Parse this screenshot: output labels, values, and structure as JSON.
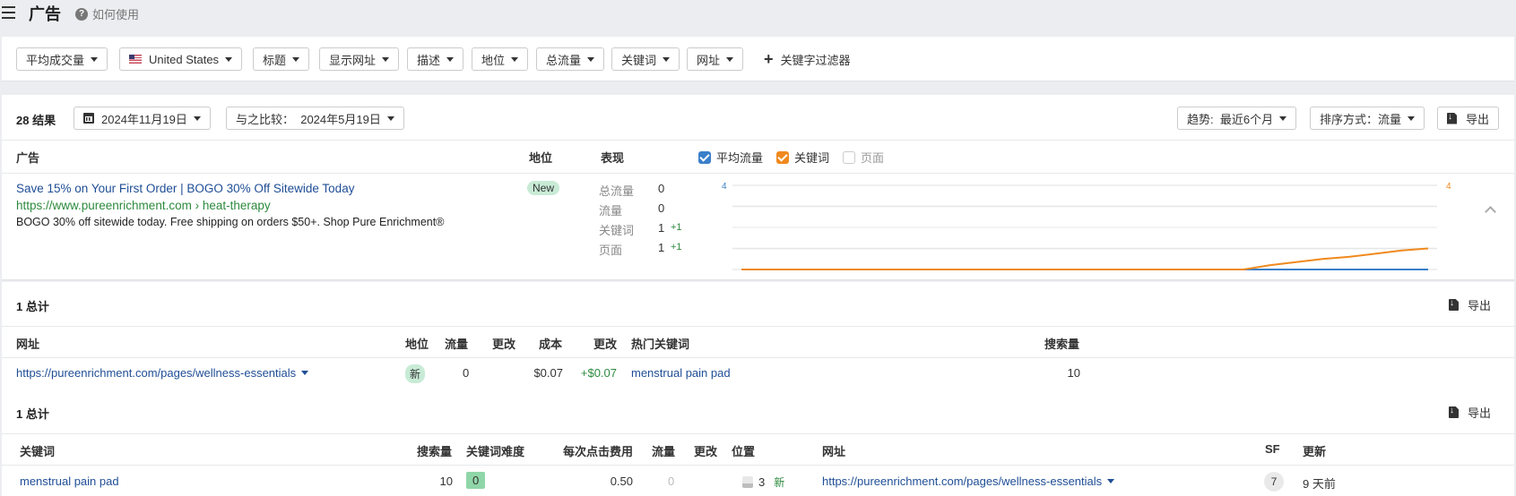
{
  "header": {
    "title": "广告",
    "help_label": "如何使用"
  },
  "filters": [
    {
      "label": "平均成交量"
    },
    {
      "label": "United States",
      "flag": "us-flag"
    },
    {
      "label": "标题"
    },
    {
      "label": "显示网址"
    },
    {
      "label": "描述"
    },
    {
      "label": "地位"
    },
    {
      "label": "总流量"
    },
    {
      "label": "关键词"
    },
    {
      "label": "网址"
    }
  ],
  "add_filter_label": "关键字过滤器",
  "toolbar": {
    "results_count": "28 结果",
    "date_label": "2024年11月19日",
    "compare_label": "与之比较：  2024年5月19日",
    "trend_label": "趋势:  最近6个月",
    "sort_label": "排序方式：流量",
    "export_label": "导出"
  },
  "ads_table": {
    "headers": {
      "ad": "广告",
      "position": "地位",
      "performance": "表现"
    },
    "legend": [
      {
        "label": "平均流量",
        "checked": true,
        "color": "#3a7fc9"
      },
      {
        "label": "关键词",
        "checked": true,
        "color": "#f0891e"
      },
      {
        "label": "页面",
        "checked": false,
        "color": "#cccccc"
      }
    ],
    "row": {
      "title": "Save 15% on Your First Order | BOGO 30% Off Sitewide Today",
      "display_url": "https://www.pureenrichment.com › heat-therapy",
      "description": "BOGO 30% off sitewide today. Free shipping on orders $50+. Shop Pure Enrichment®",
      "position_badge": "New",
      "metrics": [
        {
          "label": "总流量",
          "value": "0",
          "delta": ""
        },
        {
          "label": "流量",
          "value": "0",
          "delta": ""
        },
        {
          "label": "关键词",
          "value": "1",
          "delta": "+1"
        },
        {
          "label": "页面",
          "value": "1",
          "delta": "+1"
        }
      ]
    }
  },
  "chart_data": {
    "type": "line",
    "title": "",
    "left_axis_max_label": "4",
    "right_axis_max_label": "4",
    "ylim": [
      0,
      4
    ],
    "x": [
      0,
      1,
      2,
      3,
      4,
      5,
      6,
      7,
      8,
      9,
      10,
      11,
      12,
      13,
      14,
      15,
      16,
      17,
      18,
      19,
      20,
      21,
      22,
      23,
      24,
      25,
      26
    ],
    "series": [
      {
        "name": "平均流量",
        "color": "#3a7fc9",
        "axis": "left",
        "values": [
          0,
          0,
          0,
          0,
          0,
          0,
          0,
          0,
          0,
          0,
          0,
          0,
          0,
          0,
          0,
          0,
          0,
          0,
          0,
          0,
          0,
          0,
          0,
          0,
          0,
          0,
          0
        ]
      },
      {
        "name": "关键词",
        "color": "#f0891e",
        "axis": "right",
        "values": [
          0,
          0,
          0,
          0,
          0,
          0,
          0,
          0,
          0,
          0,
          0,
          0,
          0,
          0,
          0,
          0,
          0,
          0,
          0,
          0,
          0.2,
          0.35,
          0.5,
          0.6,
          0.75,
          0.9,
          1
        ]
      }
    ],
    "grid": true
  },
  "pages_section": {
    "total_label": "1 总计",
    "export_label": "导出",
    "headers": [
      "网址",
      "地位",
      "流量",
      "更改",
      "成本",
      "更改",
      "热门关键词",
      "搜索量"
    ],
    "rows": [
      {
        "url": "https://pureenrichment.com/pages/wellness-essentials",
        "position": "新",
        "traffic": "0",
        "traffic_change": "",
        "cost": "$0.07",
        "cost_change": "+$0.07",
        "top_keyword": "menstrual pain pad",
        "volume": "10"
      }
    ]
  },
  "keywords_section": {
    "total_label": "1 总计",
    "export_label": "导出",
    "headers": [
      "关键词",
      "搜索量",
      "关键词难度",
      "每次点击费用",
      "流量",
      "更改",
      "位置",
      "网址",
      "SF",
      "更新"
    ],
    "rows": [
      {
        "keyword": "menstrual pain pad",
        "volume": "10",
        "kd": "0",
        "cpc": "0.50",
        "traffic": "0",
        "change": "",
        "position": "3",
        "position_change": "新",
        "url": "https://pureenrichment.com/pages/wellness-essentials",
        "sf": "7",
        "updated": "9 天前"
      }
    ]
  }
}
